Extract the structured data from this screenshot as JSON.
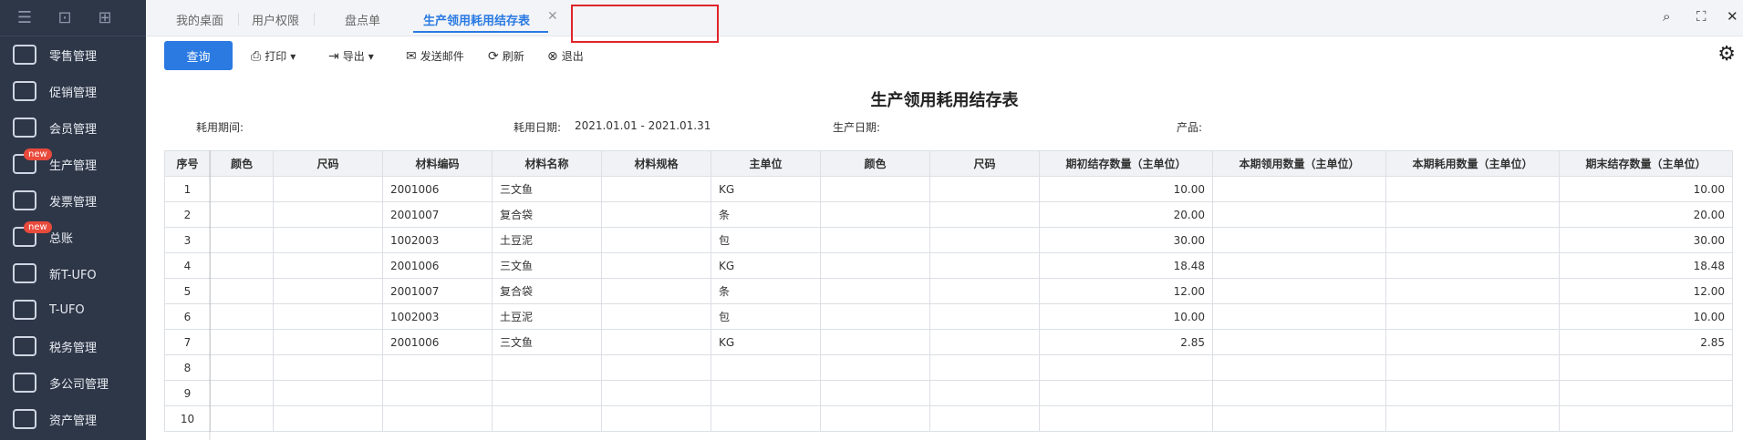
{
  "sidebar": {
    "top_icons": [
      "menu-icon",
      "search-doc-icon",
      "add-doc-icon"
    ],
    "items": [
      {
        "label": "零售管理",
        "icon": "retail-icon",
        "badge": ""
      },
      {
        "label": "促销管理",
        "icon": "megaphone-icon",
        "badge": ""
      },
      {
        "label": "会员管理",
        "icon": "member-icon",
        "badge": ""
      },
      {
        "label": "生产管理",
        "icon": "production-icon",
        "badge": "new"
      },
      {
        "label": "发票管理",
        "icon": "invoice-icon",
        "badge": ""
      },
      {
        "label": "总账",
        "icon": "ledger-icon",
        "badge": "new"
      },
      {
        "label": "新T-UFO",
        "icon": "new-tufo-icon",
        "badge": ""
      },
      {
        "label": "T-UFO",
        "icon": "tufo-icon",
        "badge": ""
      },
      {
        "label": "税务管理",
        "icon": "tax-icon",
        "badge": ""
      },
      {
        "label": "多公司管理",
        "icon": "multi-company-icon",
        "badge": ""
      },
      {
        "label": "资产管理",
        "icon": "asset-icon",
        "badge": ""
      }
    ]
  },
  "tabs": [
    {
      "label": "我的桌面"
    },
    {
      "label": "用户权限"
    },
    {
      "label": "盘点单"
    },
    {
      "label": "生产领用耗用结存表",
      "active": true
    }
  ],
  "toolbar": {
    "query": "查询",
    "print": "打印",
    "export": "导出",
    "send_mail": "发送邮件",
    "refresh": "刷新",
    "exit": "退出"
  },
  "report": {
    "title": "生产领用耗用结存表",
    "period_label": "耗用期间:",
    "date_label": "耗用日期:",
    "date_value": "2021.01.01 - 2021.01.31",
    "prod_date_label": "生产日期:",
    "product_label": "产品:"
  },
  "table": {
    "headers": [
      "序号",
      "颜色",
      "尺码",
      "材料编码",
      "材料名称",
      "材料规格",
      "主单位",
      "颜色",
      "尺码",
      "期初结存数量（主单位）",
      "本期领用数量（主单位）",
      "本期耗用数量（主单位）",
      "期末结存数量（主单位）"
    ],
    "rows": [
      [
        "1",
        "",
        "",
        "2001006",
        "三文鱼",
        "",
        "KG",
        "",
        "",
        "10.00",
        "",
        "",
        "10.00"
      ],
      [
        "2",
        "",
        "",
        "2001007",
        "复合袋",
        "",
        "条",
        "",
        "",
        "20.00",
        "",
        "",
        "20.00"
      ],
      [
        "3",
        "",
        "",
        "1002003",
        "土豆泥",
        "",
        "包",
        "",
        "",
        "30.00",
        "",
        "",
        "30.00"
      ],
      [
        "4",
        "",
        "",
        "2001006",
        "三文鱼",
        "",
        "KG",
        "",
        "",
        "18.48",
        "",
        "",
        "18.48"
      ],
      [
        "5",
        "",
        "",
        "2001007",
        "复合袋",
        "",
        "条",
        "",
        "",
        "12.00",
        "",
        "",
        "12.00"
      ],
      [
        "6",
        "",
        "",
        "1002003",
        "土豆泥",
        "",
        "包",
        "",
        "",
        "10.00",
        "",
        "",
        "10.00"
      ],
      [
        "7",
        "",
        "",
        "2001006",
        "三文鱼",
        "",
        "KG",
        "",
        "",
        "2.85",
        "",
        "",
        "2.85"
      ],
      [
        "8",
        "",
        "",
        "",
        "",
        "",
        "",
        "",
        "",
        "",
        "",
        "",
        ""
      ],
      [
        "9",
        "",
        "",
        "",
        "",
        "",
        "",
        "",
        "",
        "",
        "",
        "",
        ""
      ],
      [
        "10",
        "",
        "",
        "",
        "",
        "",
        "",
        "",
        "",
        "",
        "",
        "",
        ""
      ]
    ]
  }
}
